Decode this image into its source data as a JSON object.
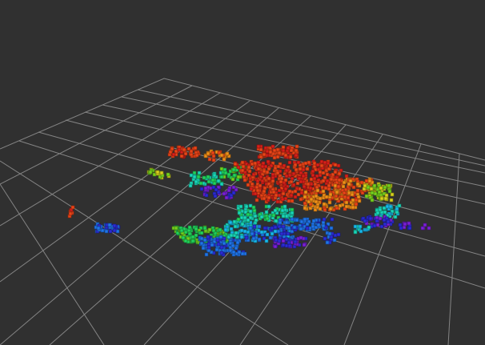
{
  "viewport": {
    "background": "#303030",
    "grid_color": "#a0a0a0",
    "colormap": [
      "#7a1fd6",
      "#2b2bd4",
      "#1f74e8",
      "#17b8ea",
      "#19d7b8",
      "#21d35a",
      "#75d11d",
      "#d7d11d",
      "#f09018",
      "#ea4418",
      "#d81f1a"
    ]
  }
}
